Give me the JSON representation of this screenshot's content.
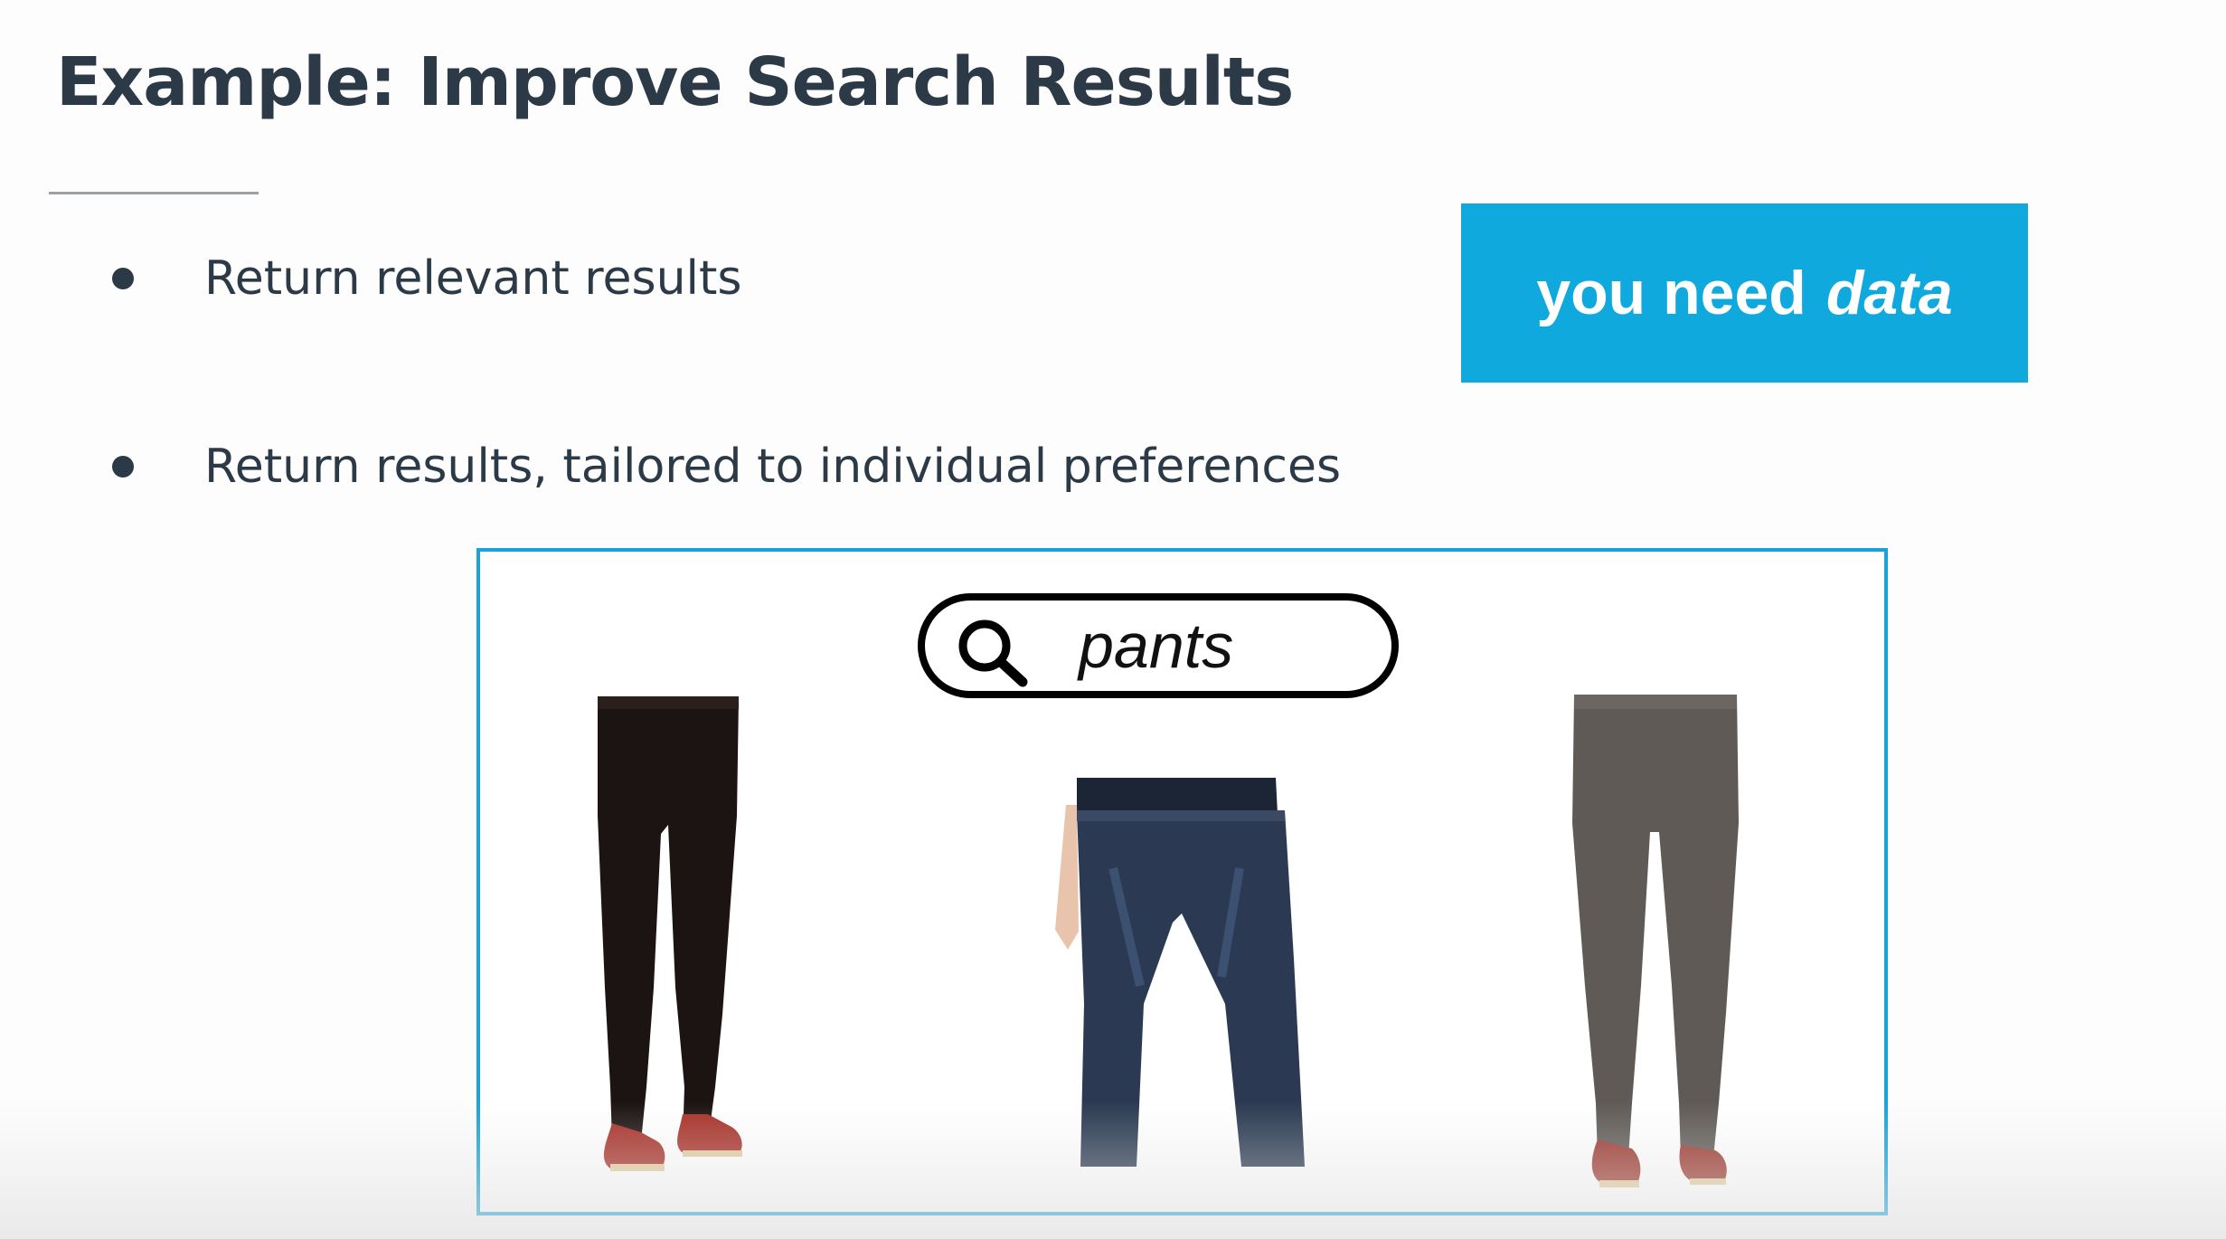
{
  "slide": {
    "title": "Example: Improve Search Results",
    "bullets": [
      "Return relevant results",
      "Return results, tailored to individual preferences"
    ],
    "callout": {
      "prefix": "you need",
      "emphasis": "data",
      "background": "#0fa9de"
    },
    "search_box": {
      "query": "pants",
      "icon": "search-icon"
    },
    "products": [
      {
        "name": "black-pants-image",
        "color": "#1c1412"
      },
      {
        "name": "blue-jeans-image",
        "color": "#2b3a52"
      },
      {
        "name": "grey-pants-image",
        "color": "#5f5a56"
      }
    ],
    "colors": {
      "title": "#2c3a47",
      "frame_border": "#1aa3d8"
    }
  }
}
